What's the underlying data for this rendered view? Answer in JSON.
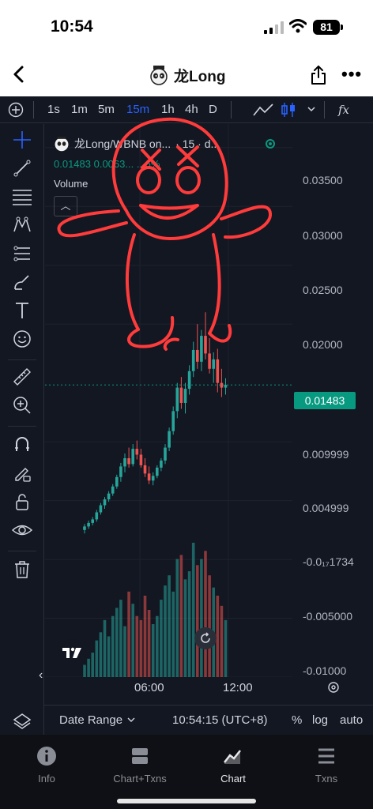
{
  "status_bar": {
    "time": "10:54",
    "battery": "81"
  },
  "nav": {
    "title": "龙Long"
  },
  "toolbar": {
    "intervals": [
      "1s",
      "1m",
      "5m",
      "15m",
      "1h",
      "4h",
      "D"
    ],
    "active_interval": "15m",
    "indicator_label": "fx"
  },
  "legend": {
    "symbol": "龙Long/WBNB on...",
    "interval": "· 15 · d...",
    "values": "0.01483  0.0063...  ...6%",
    "volume_label": "Volume"
  },
  "price_axis": {
    "ticks": [
      "0.03500",
      "0.03000",
      "0.02500",
      "0.02000",
      "0.009999",
      "0.004999",
      "-0.0₁₇1734",
      "-0.005000",
      "-0.01000"
    ],
    "current_price": "0.01483"
  },
  "time_axis": {
    "ticks": [
      "06:00",
      "12:00"
    ]
  },
  "bottom_bar": {
    "date_range": "Date Range",
    "clock": "10:54:15 (UTC+8)",
    "percent": "%",
    "log": "log",
    "auto": "auto"
  },
  "tabs": [
    {
      "label": "Info",
      "icon": "info-icon"
    },
    {
      "label": "Chart+Txns",
      "icon": "split-view-icon"
    },
    {
      "label": "Chart",
      "icon": "chart-icon",
      "active": true
    },
    {
      "label": "Txns",
      "icon": "list-icon"
    }
  ],
  "colors": {
    "background": "#131722",
    "up": "#26a69a",
    "down": "#ef5350",
    "accent": "#2962ff",
    "price_tag": "#089981",
    "doodle": "#ff3b3b"
  },
  "chart_data": {
    "type": "candlestick",
    "x_ticks": [
      "06:00",
      "12:00"
    ],
    "ylim": [
      -0.01,
      0.037
    ],
    "last_price": 0.01483,
    "series": [
      {
        "values": [
          [
            0.0025,
            0.003,
            0.0022,
            0.0028
          ],
          [
            0.0028,
            0.0033,
            0.0026,
            0.0031
          ],
          [
            0.0031,
            0.0036,
            0.0029,
            0.0034
          ],
          [
            0.0034,
            0.0042,
            0.0032,
            0.004
          ],
          [
            0.004,
            0.0048,
            0.0038,
            0.0046
          ],
          [
            0.0046,
            0.0053,
            0.0043,
            0.0051
          ],
          [
            0.0051,
            0.0058,
            0.0049,
            0.0056
          ],
          [
            0.0056,
            0.0064,
            0.0054,
            0.0062
          ],
          [
            0.0062,
            0.0072,
            0.006,
            0.007
          ],
          [
            0.007,
            0.0082,
            0.0066,
            0.0079
          ],
          [
            0.0079,
            0.009,
            0.0074,
            0.0086
          ],
          [
            0.0086,
            0.0095,
            0.0078,
            0.0081
          ],
          [
            0.0081,
            0.0098,
            0.0079,
            0.0094
          ],
          [
            0.0094,
            0.0101,
            0.0085,
            0.0089
          ],
          [
            0.0089,
            0.0094,
            0.0078,
            0.008
          ],
          [
            0.008,
            0.0086,
            0.007,
            0.0073
          ],
          [
            0.0073,
            0.0079,
            0.0064,
            0.0067
          ],
          [
            0.0067,
            0.0074,
            0.0063,
            0.0071
          ],
          [
            0.0071,
            0.008,
            0.0069,
            0.0078
          ],
          [
            0.0078,
            0.0086,
            0.0075,
            0.0084
          ],
          [
            0.0084,
            0.0098,
            0.0081,
            0.0095
          ],
          [
            0.0095,
            0.0112,
            0.0092,
            0.0109
          ],
          [
            0.0109,
            0.013,
            0.0106,
            0.0126
          ],
          [
            0.0126,
            0.015,
            0.012,
            0.0146
          ],
          [
            0.0146,
            0.0155,
            0.0128,
            0.0133
          ],
          [
            0.0133,
            0.015,
            0.0124,
            0.0145
          ],
          [
            0.0145,
            0.0165,
            0.014,
            0.016
          ],
          [
            0.016,
            0.0185,
            0.0155,
            0.0178
          ],
          [
            0.0178,
            0.02,
            0.0162,
            0.0168
          ],
          [
            0.0168,
            0.0195,
            0.016,
            0.019
          ],
          [
            0.019,
            0.021,
            0.017,
            0.0175
          ],
          [
            0.0175,
            0.0188,
            0.0158,
            0.0162
          ],
          [
            0.0162,
            0.0176,
            0.015,
            0.017
          ],
          [
            0.017,
            0.0179,
            0.0142,
            0.015
          ],
          [
            0.015,
            0.0162,
            0.0138,
            0.0146
          ],
          [
            0.0146,
            0.0154,
            0.014,
            0.01483
          ]
        ]
      }
    ],
    "volume": [
      6,
      9,
      12,
      18,
      22,
      28,
      20,
      30,
      34,
      38,
      25,
      42,
      36,
      30,
      28,
      40,
      33,
      26,
      30,
      38,
      45,
      50,
      42,
      58,
      60,
      48,
      52,
      66,
      55,
      58,
      62,
      50,
      44,
      40,
      35,
      28
    ]
  }
}
